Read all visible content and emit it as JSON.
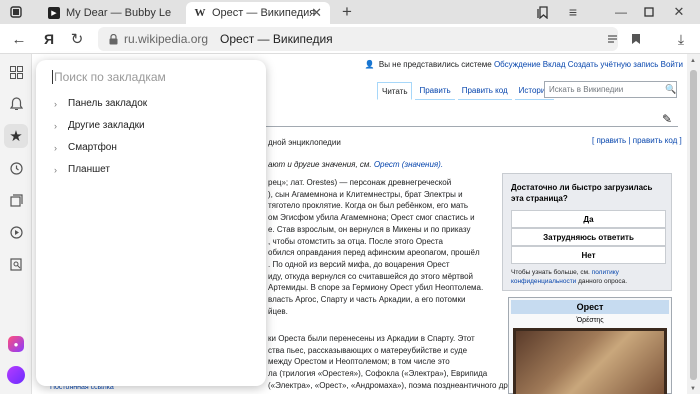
{
  "tabs": [
    {
      "title": "My Dear — Bubby Le"
    },
    {
      "title": "Орест — Википедия"
    }
  ],
  "address": {
    "domain": "ru.wikipedia.org",
    "title": "Орест — Википедия"
  },
  "wiki": {
    "toplinks": {
      "not_logged": "Вы не представились системе",
      "discussion": "Обсуждение",
      "contrib": "Вклад",
      "create": "Создать учётную запись",
      "login": "Войти"
    },
    "tabs": [
      "Читать",
      "Править",
      "Править код",
      "История"
    ],
    "search_placeholder": "Искать в Википедии",
    "subtitle": "дной энциклопедии",
    "edit_links": "[ править | править код ]",
    "hatnote": "ают и другие значения, см. ",
    "hatnote_link": "Орест (значения).",
    "para1": [
      "рец»; лат. Orestes) — персонаж древнегреческой",
      "), сын Агамемнона и Клитемнестры, брат Электры и",
      "тяготело проклятие. Когда он был ребёнком, его мать",
      "ом Эгисфом убила Агамемнона; Орест смог спастись и",
      "е. Став взрослым, он вернулся в Микены и по приказу",
      ", чтобы отомстить за отца. После этого Ореста",
      "обился оправдания перед афинским ареопагом, прошёл",
      ". По одной из версий мифа, до воцарения Орест",
      "иду, откуда вернулся со считавшейся до этого мёртвой",
      "Артемиды. В споре за Гермиону Орест убил Неоптолема.",
      "власть Аргос, Спарту и часть Аркадии, а его потомки",
      "йцев."
    ],
    "para2": [
      "ки Ореста были перенесены из Аркадии в Спарту. Этот",
      "ства пьес, рассказывающих о матереубийстве и суде",
      " между Орестом и Неоптолемом; в том числе это",
      "ла (трилогия «Орестея»), Софокла («Электра»), Еврипида",
      "(«Электра», «Орест», «Андромаха»), поэма позднеантичного драматурга Драконция, в"
    ],
    "feedback": {
      "question": "Достаточно ли быстро загрузилась эта страница?",
      "yes": "Да",
      "hard": "Затрудняюсь ответить",
      "no": "Нет",
      "note1": "Чтобы узнать больше, см. ",
      "note_link": "политику конфиденциальности",
      "note2": " данного опроса."
    },
    "infobox": {
      "title": "Орест",
      "greek": "Ὀρέστης"
    },
    "sidebar_bottom": "Постоянная ссылка"
  },
  "bookmarks": {
    "placeholder": "Поиск по закладкам",
    "items": [
      "Панель закладок",
      "Другие закладки",
      "Смартфон",
      "Планшет"
    ]
  }
}
